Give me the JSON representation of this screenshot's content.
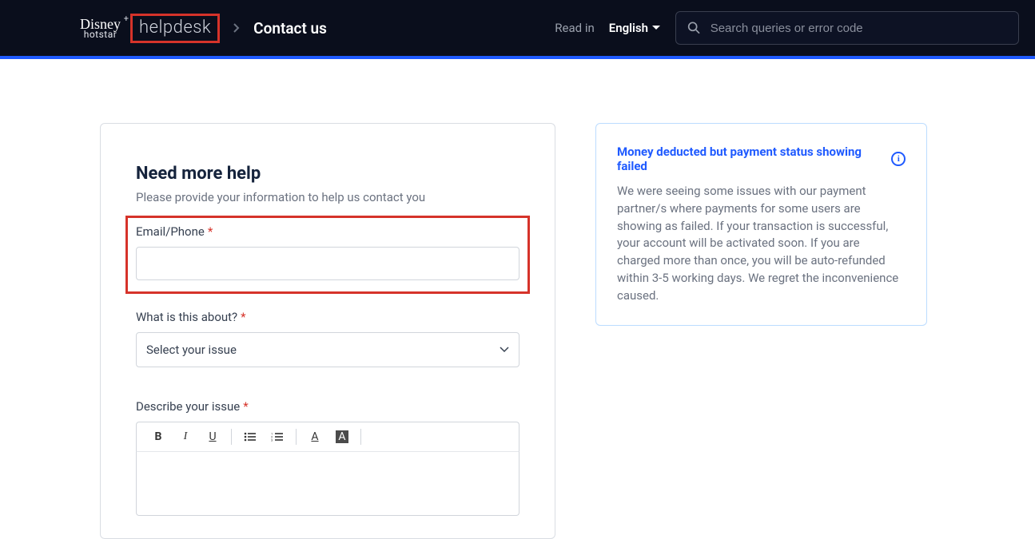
{
  "header": {
    "brand_top": "Disney",
    "brand_plus": "+",
    "brand_bottom": "hotstar",
    "helpdesk": "helpdesk",
    "page": "Contact us",
    "read_in": "Read in",
    "language": "English",
    "search_placeholder": "Search queries or error code"
  },
  "form": {
    "title": "Need more help",
    "subtitle": "Please provide your information to help us contact you",
    "email_label": "Email/Phone",
    "about_label": "What is this about?",
    "about_placeholder": "Select your issue",
    "describe_label": "Describe your issue"
  },
  "toolbar": {
    "bold": "B",
    "italic": "I",
    "underline": "U",
    "font_a": "A",
    "bg_a": "A"
  },
  "notice": {
    "title": "Money deducted but payment status showing failed",
    "body": "We were seeing some issues with our payment partner/s where payments for some users are showing as failed. If your transaction is successful, your account will be activated soon. If you are charged more than once, you will be auto-refunded within 3-5 working days. We regret the inconvenience caused."
  }
}
